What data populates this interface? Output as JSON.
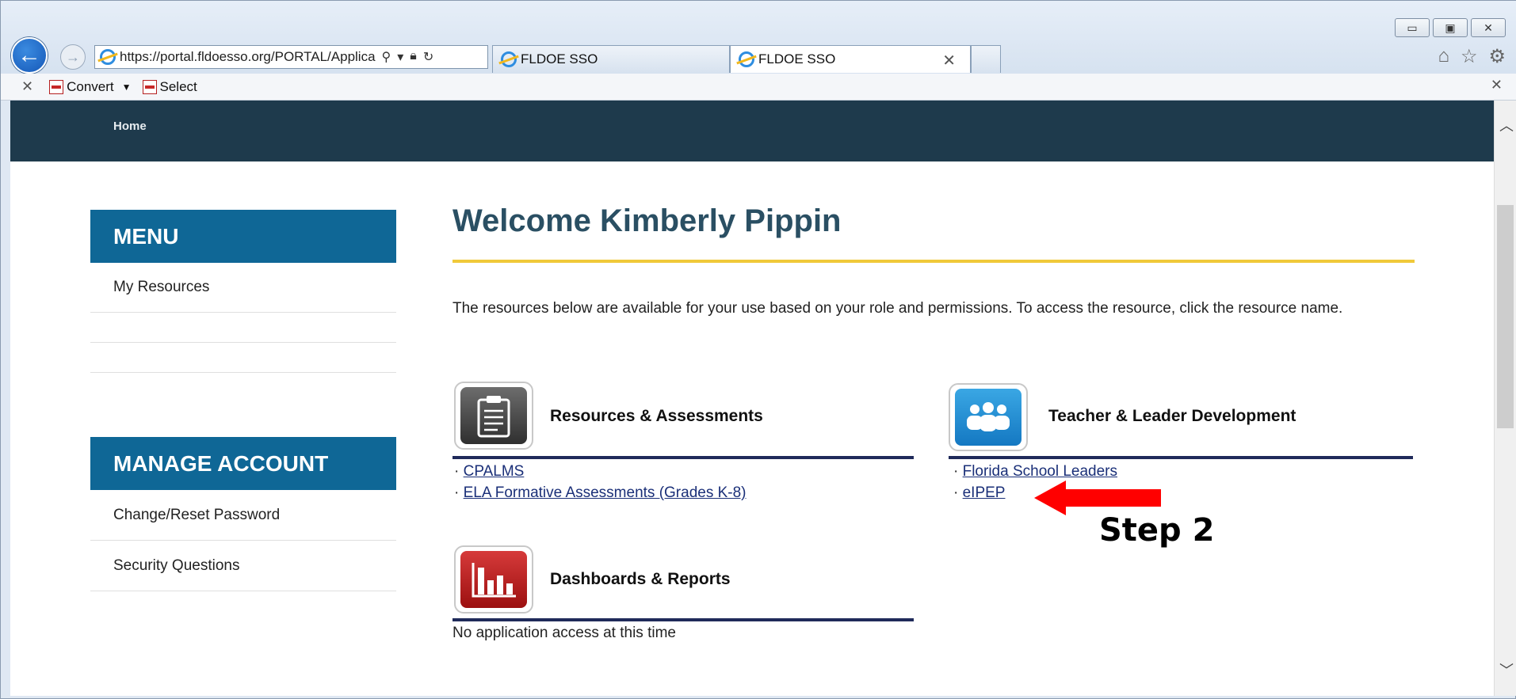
{
  "browser": {
    "address": "https://portal.fldoesso.org/PORTAL/Applica",
    "tabs": [
      {
        "label": "FLDOE SSO"
      },
      {
        "label": "FLDOE SSO"
      }
    ],
    "command_bar": {
      "convert_label": "Convert",
      "select_label": "Select"
    }
  },
  "nav": {
    "home_label": "Home"
  },
  "sidebar": {
    "menu_heading": "MENU",
    "menu_items": [
      "My Resources",
      "",
      ""
    ],
    "account_heading": "MANAGE ACCOUNT",
    "account_items": [
      "Change/Reset Password",
      "Security Questions"
    ]
  },
  "main": {
    "welcome": "Welcome Kimberly Pippin",
    "intro": "The resources below are available for your use based on your role and permissions. To access the resource, click the resource name.",
    "sections": [
      {
        "title": "Resources & Assessments",
        "icon": "clipboard-icon",
        "links": [
          "CPALMS",
          "ELA Formative Assessments (Grades K-8)"
        ]
      },
      {
        "title": "Teacher & Leader Development",
        "icon": "people-group-icon",
        "links": [
          "Florida School Leaders",
          "eIPEP"
        ]
      },
      {
        "title": "Dashboards & Reports",
        "icon": "bar-chart-icon",
        "links": [],
        "empty_message": "No application access at this time"
      }
    ]
  },
  "annotation": {
    "label": "Step 2",
    "arrow_color": "#ff0000"
  },
  "colors": {
    "nav_bg": "#1e3a4c",
    "menu_head_bg": "#0f6796",
    "accent_rule": "#f0c93a",
    "section_rule": "#1f2a5a",
    "link": "#1a2f78"
  }
}
